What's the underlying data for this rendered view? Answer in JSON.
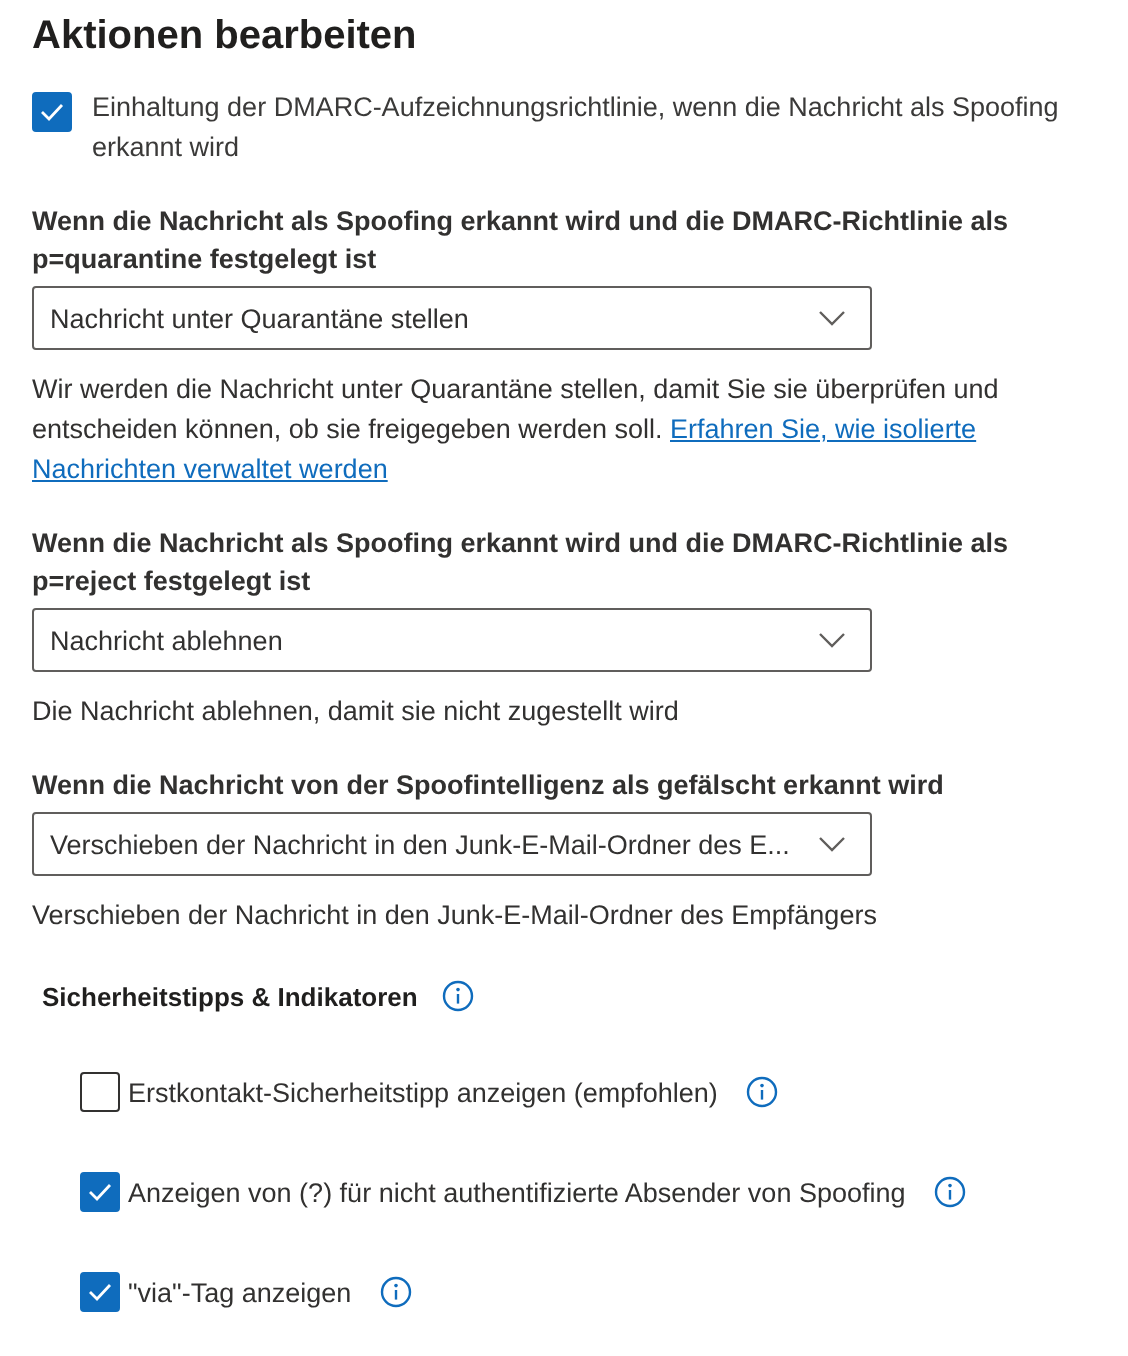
{
  "title": "Aktionen bearbeiten",
  "dmarc_checkbox": {
    "label": "Einhaltung der DMARC-Aufzeichnungsrichtlinie, wenn die Nachricht als Spoofing erkannt wird",
    "checked": true
  },
  "sections": [
    {
      "label": "Wenn die Nachricht als Spoofing erkannt wird und die DMARC-Richtlinie als p=quarantine festgelegt ist",
      "value": "Nachricht unter Quarantäne stellen",
      "description": "Wir werden die Nachricht unter Quarantäne stellen, damit Sie sie überprüfen und entscheiden können, ob sie freigegeben werden soll.",
      "link_parts": [
        "Erfahren Sie, wie isolierte",
        "Nachrichten verwaltet werden"
      ]
    },
    {
      "label": "Wenn die Nachricht als Spoofing erkannt wird und die DMARC-Richtlinie als p=reject festgelegt ist",
      "value": "Nachricht ablehnen",
      "description": "Die Nachricht ablehnen, damit sie nicht zugestellt wird"
    },
    {
      "label": "Wenn die Nachricht von der Spoofintelligenz als gefälscht erkannt wird",
      "value": "Verschieben der Nachricht in den Junk-E-Mail-Ordner des E...",
      "description": "Verschieben der Nachricht in den Junk-E-Mail-Ordner des Empfängers"
    }
  ],
  "safety": {
    "heading": "Sicherheitstipps & Indikatoren",
    "options": [
      {
        "label": "Erstkontakt-Sicherheitstipp anzeigen (empfohlen)",
        "checked": false
      },
      {
        "label": "Anzeigen von (?) für nicht authentifizierte Absender von Spoofing",
        "checked": true
      },
      {
        "label": "\"via\"-Tag anzeigen",
        "checked": true
      }
    ]
  }
}
